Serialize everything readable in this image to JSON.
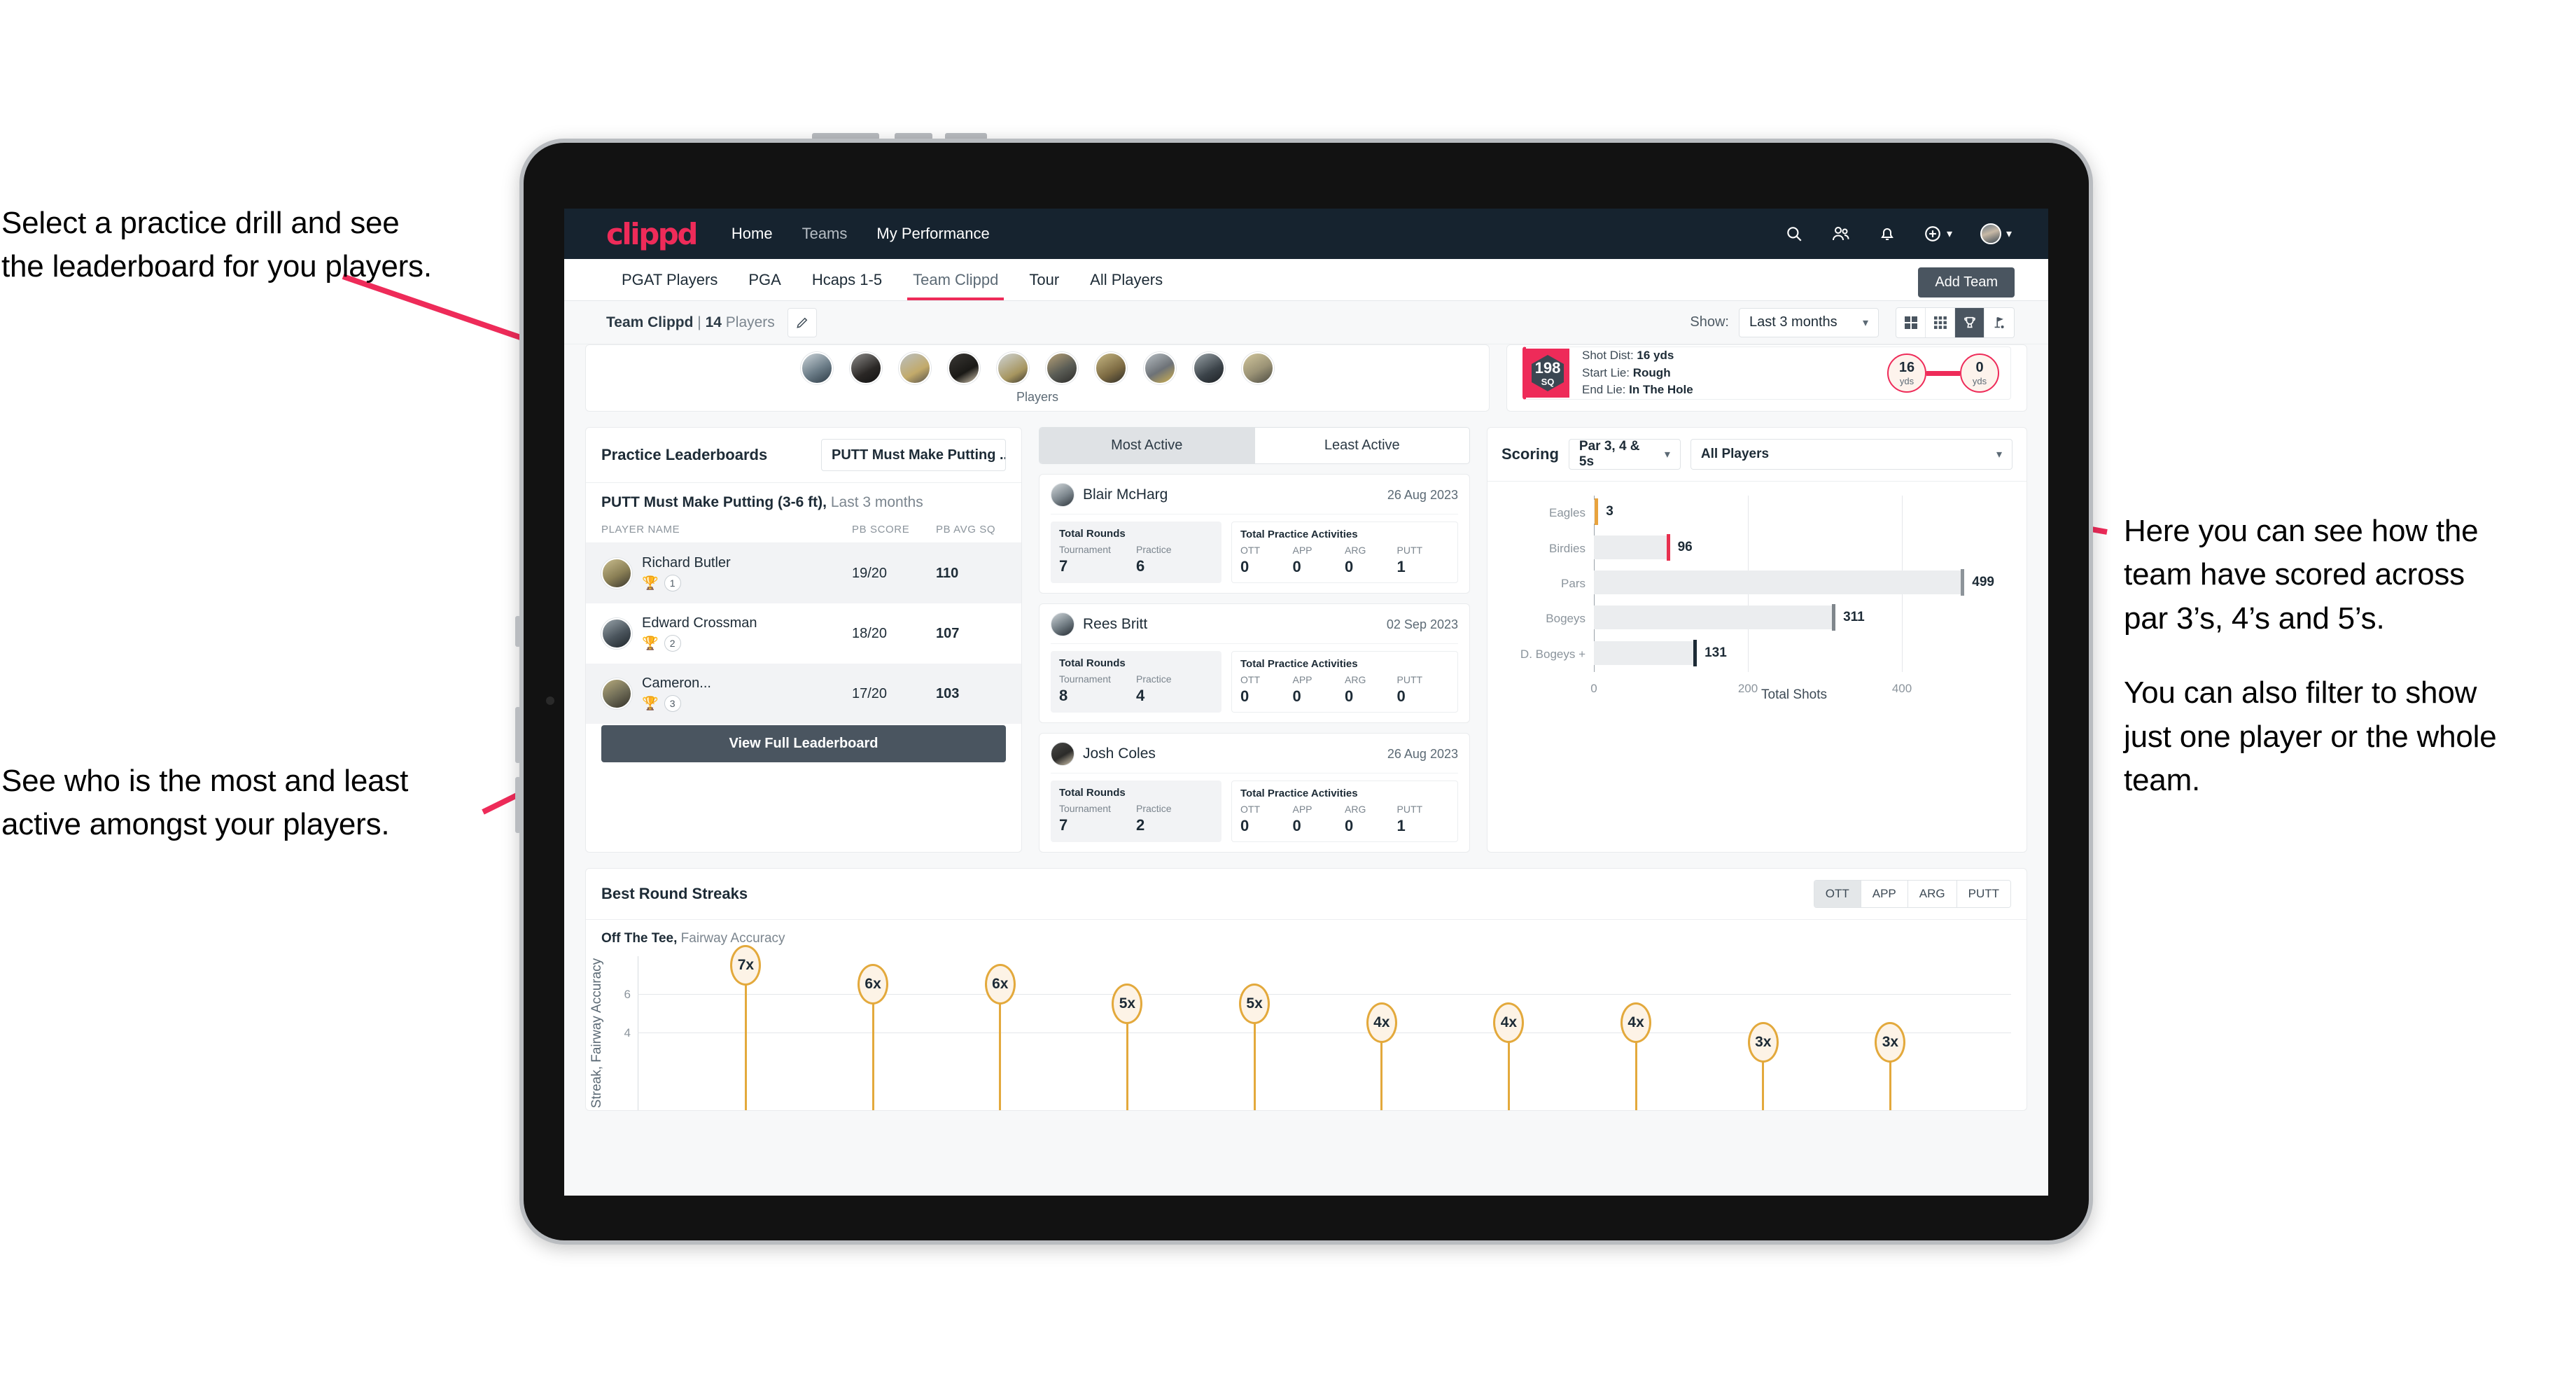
{
  "annotations": {
    "top_left": [
      "Select a practice drill and see",
      "the leaderboard for you players."
    ],
    "mid_left": [
      "See who is the most and least",
      "active amongst your players."
    ],
    "right_1": [
      "Here you can see how the",
      "team have scored across",
      "par 3’s, 4’s and 5’s."
    ],
    "right_2": [
      "You can also filter to show",
      "just one player or the whole",
      "team."
    ]
  },
  "topnav": {
    "logo": "clippd",
    "links": [
      {
        "label": "Home",
        "dim": false
      },
      {
        "label": "Teams",
        "dim": true
      },
      {
        "label": "My Performance",
        "dim": false
      }
    ],
    "icons": [
      "search-icon",
      "people-icon",
      "bell-icon",
      "plus-circle-icon",
      "avatar"
    ]
  },
  "tabs": {
    "items": [
      "PGAT Players",
      "PGA",
      "Hcaps 1-5",
      "Team Clippd",
      "Tour",
      "All Players"
    ],
    "active": "Team Clippd",
    "add_team_label": "Add Team"
  },
  "subheader": {
    "team_name": "Team Clippd",
    "separator": " | ",
    "player_count": "14",
    "players_word": " Players",
    "edit_icon": "pencil-icon",
    "show_label": "Show:",
    "show_value": "Last 3 months",
    "view_toggles": [
      "grid-2x2-icon",
      "grid-3x3-icon",
      "trophy-icon",
      "flag-icon"
    ],
    "view_selected_index": 2
  },
  "players_strip": {
    "label": "Players",
    "avatar_count": 10
  },
  "shot_card": {
    "sq_value": "198",
    "sq_unit": "SQ",
    "lines": [
      {
        "label": "Shot Dist: ",
        "value": "16 yds"
      },
      {
        "label": "Start Lie: ",
        "value": "Rough"
      },
      {
        "label": "End Lie: ",
        "value": "In The Hole"
      }
    ],
    "start_yards": "16",
    "start_unit": "yds",
    "end_yards": "0",
    "end_unit": "yds"
  },
  "leaderboard": {
    "title": "Practice Leaderboards",
    "drill_select": "PUTT Must Make Putting ...",
    "subtitle_bold": "PUTT Must Make Putting (3-6 ft),",
    "subtitle_light": " Last 3 months",
    "columns": [
      "PLAYER NAME",
      "PB SCORE",
      "PB AVG SQ"
    ],
    "rows": [
      {
        "name": "Richard Butler",
        "rank": "1",
        "trophy": "gold",
        "pb_score": "19/20",
        "pb_avg_sq": "110"
      },
      {
        "name": "Edward Crossman",
        "rank": "2",
        "trophy": "silver",
        "pb_score": "18/20",
        "pb_avg_sq": "107"
      },
      {
        "name": "Cameron...",
        "rank": "3",
        "trophy": "bronze",
        "pb_score": "17/20",
        "pb_avg_sq": "103"
      }
    ],
    "view_full_label": "View Full Leaderboard"
  },
  "activity": {
    "tabs": [
      "Most Active",
      "Least Active"
    ],
    "selected_tab": "Most Active",
    "rounds_title": "Total Rounds",
    "rounds_labels": [
      "Tournament",
      "Practice"
    ],
    "practice_title": "Total Practice Activities",
    "practice_labels": [
      "OTT",
      "APP",
      "ARG",
      "PUTT"
    ],
    "cards": [
      {
        "name": "Blair McHarg",
        "date": "26 Aug 2023",
        "rounds": [
          "7",
          "6"
        ],
        "practice": [
          "0",
          "0",
          "0",
          "1"
        ]
      },
      {
        "name": "Rees Britt",
        "date": "02 Sep 2023",
        "rounds": [
          "8",
          "4"
        ],
        "practice": [
          "0",
          "0",
          "0",
          "0"
        ]
      },
      {
        "name": "Josh Coles",
        "date": "26 Aug 2023",
        "rounds": [
          "7",
          "2"
        ],
        "practice": [
          "0",
          "0",
          "0",
          "1"
        ]
      }
    ]
  },
  "scoring": {
    "title": "Scoring",
    "par_select": "Par 3, 4 & 5s",
    "player_select": "All Players",
    "chart_data": {
      "type": "bar",
      "orientation": "horizontal",
      "title": "Scoring",
      "categories": [
        "Eagles",
        "Birdies",
        "Pars",
        "Bogeys",
        "D. Bogeys +"
      ],
      "values": [
        3,
        96,
        499,
        311,
        131
      ],
      "cap_colors": [
        "#e8a33d",
        "#e8304f",
        "#8d949a",
        "#7f868c",
        "#1d2b36"
      ],
      "xlabel": "Total Shots",
      "ylabel": "",
      "xticks": [
        0,
        200,
        400
      ],
      "xlim": [
        0,
        520
      ],
      "grid": true,
      "legend": "none"
    }
  },
  "streaks": {
    "title": "Best Round Streaks",
    "toggle": [
      "OTT",
      "APP",
      "ARG",
      "PUTT"
    ],
    "toggle_selected": "OTT",
    "subtitle_bold": "Off The Tee,",
    "subtitle_light": " Fairway Accuracy",
    "chart_data": {
      "type": "scatter",
      "variant": "lollipop",
      "title": "Off The Tee, Fairway Accuracy",
      "ylabel": "Streak, Fairway Accuracy",
      "yticks": [
        4,
        6
      ],
      "ylim": [
        0,
        8
      ],
      "values": [
        7,
        6,
        6,
        5,
        5,
        4,
        4,
        4,
        3,
        3
      ],
      "labels": [
        "7x",
        "6x",
        "6x",
        "5x",
        "5x",
        "4x",
        "4x",
        "4x",
        "3x",
        "3x"
      ],
      "grid": true
    }
  }
}
